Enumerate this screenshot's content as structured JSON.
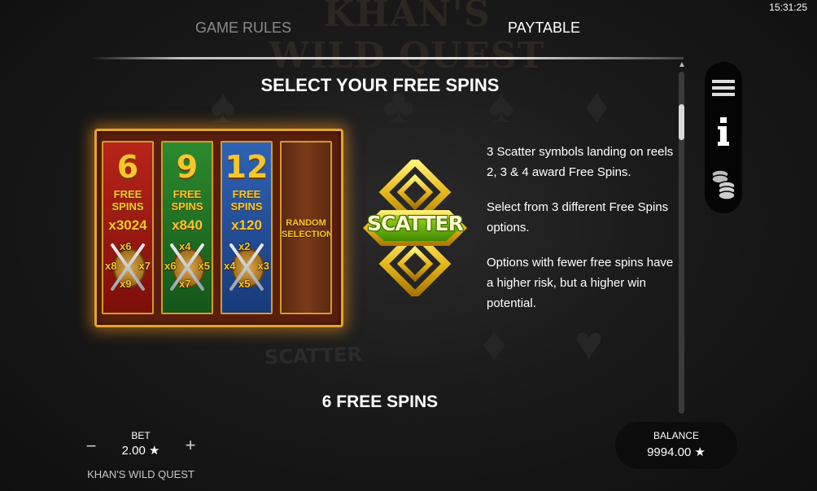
{
  "header": {
    "background_title": "KHAN'S WILD QUEST",
    "clock": "15:31:25",
    "tabs": [
      {
        "label": "GAME RULES",
        "active": false
      },
      {
        "label": "PAYTABLE",
        "active": true
      }
    ]
  },
  "side_menu": {
    "items": [
      {
        "icon": "menu-icon"
      },
      {
        "icon": "info-icon"
      },
      {
        "icon": "coins-icon"
      }
    ]
  },
  "content": {
    "heading": "SELECT YOUR FREE SPINS",
    "options": [
      {
        "spins": "6",
        "label_line1": "FREE",
        "label_line2": "SPINS",
        "multiplier": "x3024",
        "mults": [
          "x6",
          "x8",
          "x7",
          "x9"
        ],
        "color": "#b8241a"
      },
      {
        "spins": "9",
        "label_line1": "FREE",
        "label_line2": "SPINS",
        "multiplier": "x840",
        "mults": [
          "x4",
          "x6",
          "x5",
          "x7"
        ],
        "color": "#2b8a2f"
      },
      {
        "spins": "12",
        "label_line1": "FREE",
        "label_line2": "SPINS",
        "multiplier": "x120",
        "mults": [
          "x2",
          "x4",
          "x3",
          "x5"
        ],
        "color": "#2f63b5"
      }
    ],
    "random": {
      "line1": "RANDOM",
      "line2": "SELECTION"
    },
    "scatter_symbol_text": "SCATTER",
    "description": [
      "3 Scatter symbols landing on reels 2, 3 & 4 award Free Spins.",
      "Select from 3 different Free Spins options.",
      "Options with fewer free spins have a higher risk, but a higher win potential."
    ],
    "selection_result": "6 FREE SPINS",
    "background_scatter": "SCATTER"
  },
  "footer": {
    "bet_label": "BET",
    "bet_value": "2.00 ★",
    "minus": "−",
    "plus": "+",
    "game_name": "KHAN'S WILD QUEST",
    "balance_label": "BALANCE",
    "balance_value": "9994.00 ★"
  }
}
